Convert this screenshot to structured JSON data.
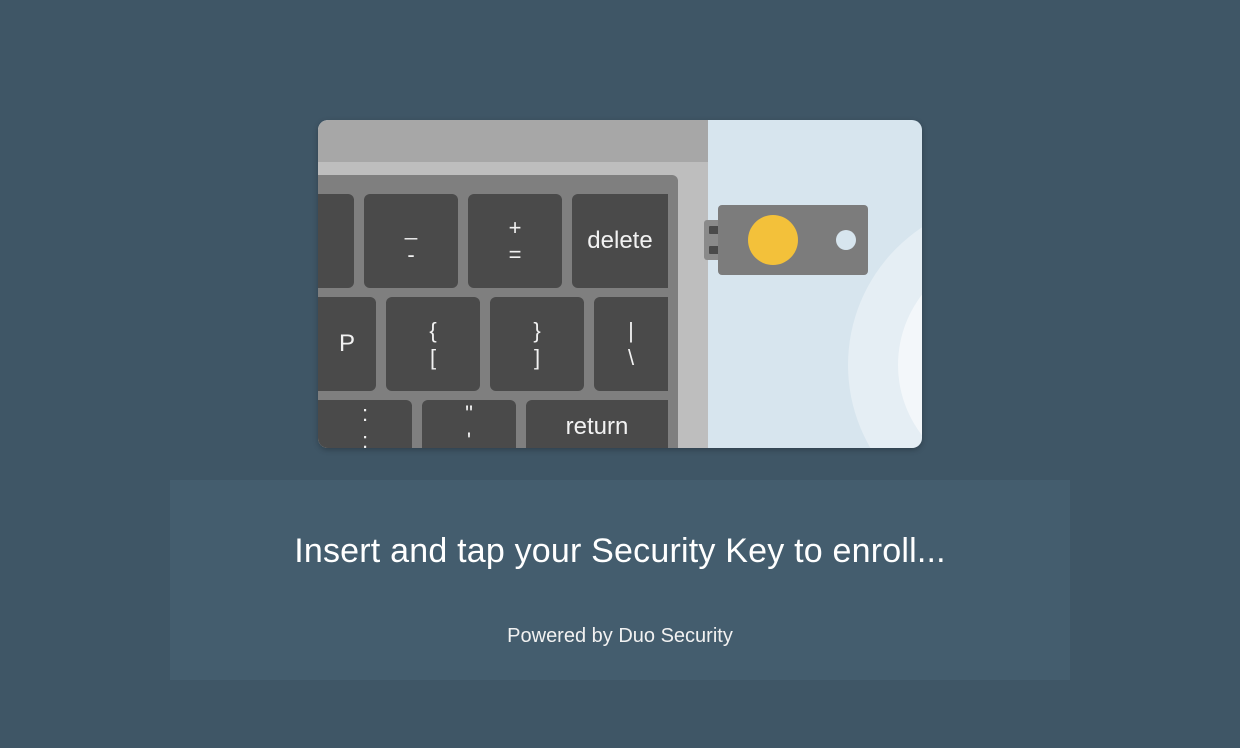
{
  "illustration": {
    "keys": {
      "r1b_top": "_",
      "r1b_bot": "-",
      "r1c_top": "+",
      "r1c_bot": "=",
      "r1d": "delete",
      "r2a": "P",
      "r2b_top": "{",
      "r2b_bot": "[",
      "r2c_top": "}",
      "r2c_bot": "]",
      "r2d_top": "|",
      "r2d_bot": "\\",
      "r3a_top": ":",
      "r3a_bot": ";",
      "r3b_top": "\"",
      "r3b_bot": "'",
      "r3c": "return"
    }
  },
  "message": {
    "instruction": "Insert and tap your Security Key to enroll...",
    "powered_by": "Powered by Duo Security"
  }
}
